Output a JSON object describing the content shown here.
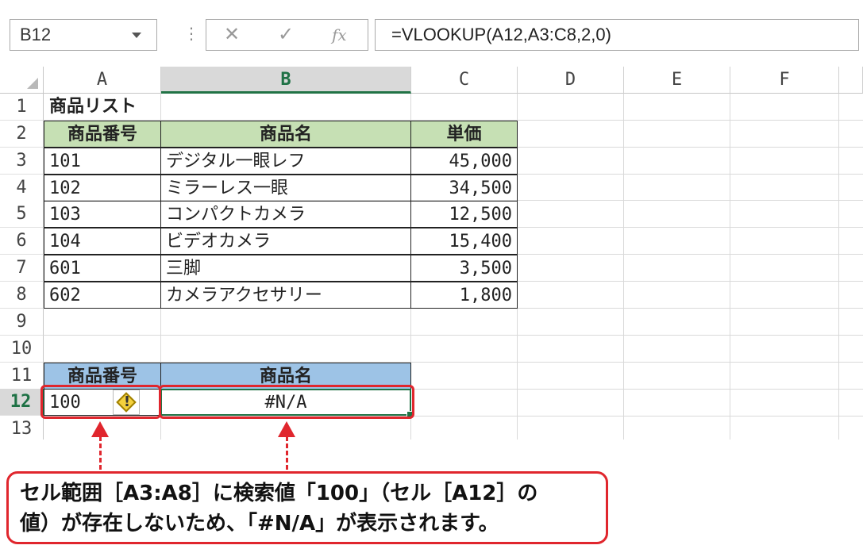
{
  "formula_bar": {
    "name_box": "B12",
    "cancel_glyph": "✕",
    "enter_glyph": "✓",
    "fx_glyph": "fx",
    "formula": "=VLOOKUP(A12,A3:C8,2,0)"
  },
  "columns": [
    "A",
    "B",
    "C",
    "D",
    "E",
    "F"
  ],
  "rows": [
    "1",
    "2",
    "3",
    "4",
    "5",
    "6",
    "7",
    "8",
    "9",
    "10",
    "11",
    "12",
    "13"
  ],
  "selected_cell": {
    "column": "B",
    "row": "12"
  },
  "table": {
    "title": "商品リスト",
    "headers": [
      "商品番号",
      "商品名",
      "単価"
    ],
    "rows": [
      [
        "101",
        "デジタル一眼レフ",
        "45,000"
      ],
      [
        "102",
        "ミラーレス一眼",
        "34,500"
      ],
      [
        "103",
        "コンパクトカメラ",
        "12,500"
      ],
      [
        "104",
        "ビデオカメラ",
        "15,400"
      ],
      [
        "601",
        "三脚",
        "3,500"
      ],
      [
        "602",
        "カメラアクセサリー",
        "1,800"
      ]
    ]
  },
  "lookup": {
    "headers": [
      "商品番号",
      "商品名"
    ],
    "input_value": "100",
    "result": "#N/A",
    "warning_icon": "error-warning-icon"
  },
  "callout": {
    "line1": "セル範囲［A3:A8］に検索値「100」（セル［A12］の",
    "line2": "値）が存在しないため、「#N/A」が表示されます。"
  },
  "colors": {
    "header_green": "#c6e0b4",
    "header_blue": "#9dc3e6",
    "excel_green": "#217346",
    "annotation_red": "#e0262d"
  }
}
